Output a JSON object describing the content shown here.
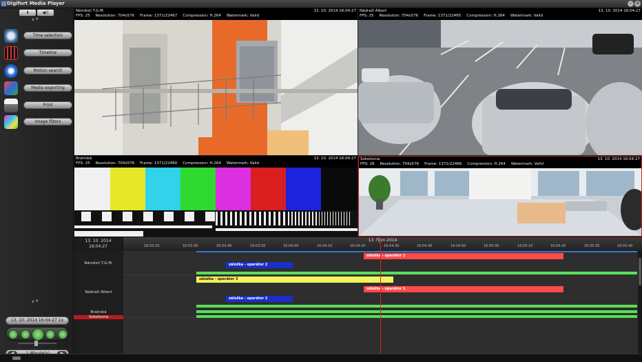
{
  "window": {
    "title": "Digifort Media Player"
  },
  "sidebar": {
    "top_buttons": [
      "⬇",
      "◀))"
    ],
    "items": [
      {
        "label": "Time selection",
        "icon": "clock-icon"
      },
      {
        "label": "Timeline",
        "icon": "film-icon"
      },
      {
        "label": "Motion search",
        "icon": "motion-search-icon"
      },
      {
        "label": "Media exporting",
        "icon": "export-icon"
      },
      {
        "label": "Print",
        "icon": "printer-icon"
      },
      {
        "label": "Image filters",
        "icon": "image-filter-icon"
      }
    ],
    "current_time": "13. 10. 2014 16:04:27 1x",
    "speed": "1 Minute(s)"
  },
  "cameras": [
    {
      "name": "Náměstí T.G.M.",
      "timestamp": "13. 10. 2014 16:04:27",
      "fps": "FPS: 25",
      "resolution": "Resolution: 704x576",
      "frame": "Frame: 1371/22467",
      "compression": "Compression: H.264",
      "watermark": "Watermark: Valid"
    },
    {
      "name": "Nádraží Albert",
      "timestamp": "13. 10. 2014 16:04:27",
      "fps": "FPS: 25",
      "resolution": "Resolution: 704x576",
      "frame": "Frame: 1371/22465",
      "compression": "Compression: H.264",
      "watermark": "Watermark: Valid"
    },
    {
      "name": "Bratrská",
      "timestamp": "13. 10. 2014 16:04:27",
      "fps": "FPS: 25",
      "resolution": "Resolution: 704x576",
      "frame": "Frame: 1371/22460",
      "compression": "Compression: H.264",
      "watermark": "Watermark: Valid"
    },
    {
      "name": "Sokolovna",
      "timestamp": "13. 10. 2014 16:04:27",
      "fps": "FPS: 26",
      "resolution": "Resolution: 704x576",
      "frame": "Frame: 1371/22466",
      "compression": "Compression: H.264",
      "watermark": "Watermark: Valid"
    }
  ],
  "timeline": {
    "date": "13. 10. 2014",
    "time": "16:04:27",
    "header": "13. říjen 2014",
    "ticks": [
      "16:03:20",
      "16:03:30",
      "16:03:40",
      "16:03:50",
      "16:04:00",
      "16:04:10",
      "16:04:20",
      "16:04:30",
      "16:04:40",
      "16:04:50",
      "16:05:00",
      "16:05:10",
      "16:05:20",
      "16:05:30",
      "16:05:40"
    ],
    "rows": [
      "Náměstí T.G.M.",
      "Nádraží Albert",
      "Bratrská",
      "Sokolovna"
    ],
    "events": [
      {
        "label": "záložka - operátor 1",
        "color": "#ff4a4a"
      },
      {
        "label": "záložka - operátor 2",
        "color": "#1a2fc7"
      },
      {
        "label": "záložka - operátor 3",
        "color": "#f2f25a"
      },
      {
        "label": "záložka - operátor 1",
        "color": "#ff4a4a"
      },
      {
        "label": "záložka - operátor 2",
        "color": "#1a2fc7"
      }
    ]
  }
}
